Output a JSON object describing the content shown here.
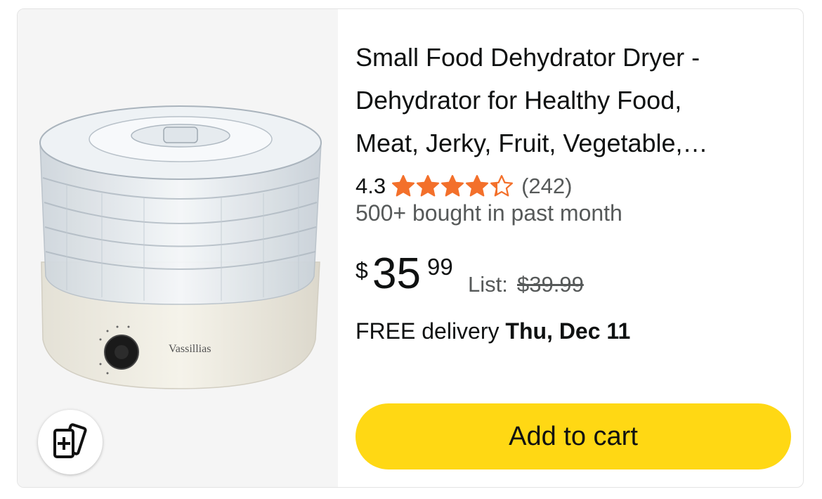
{
  "product": {
    "title": "Small Food Dehydrator Dryer - Dehydrator for Healthy Food, Meat, Jerky, Fruit, Vegetable,…",
    "title_lines": [
      "Small Food Dehydrator Dryer -",
      "Dehydrator for Healthy Food,",
      "Meat, Jerky, Fruit, Vegetable,…"
    ],
    "rating": "4.3",
    "rating_value": 4.3,
    "stars_max": 5,
    "review_count": "(242)",
    "bought_text": "500+ bought in past month",
    "price": {
      "symbol": "$",
      "whole": "35",
      "fraction": "99"
    },
    "list_label": "List:",
    "list_price": "$39.99",
    "delivery_prefix": "FREE delivery",
    "delivery_date": "Thu, Dec 11",
    "image_brand_text": "Vassillias"
  },
  "actions": {
    "add_to_cart_label": "Add to cart",
    "compare_icon": "compare-add-icon"
  },
  "colors": {
    "star": "#f3702b",
    "button": "#ffd814",
    "image_background": "#f5f5f5",
    "text_primary": "#0f1111",
    "text_secondary": "#565959"
  }
}
